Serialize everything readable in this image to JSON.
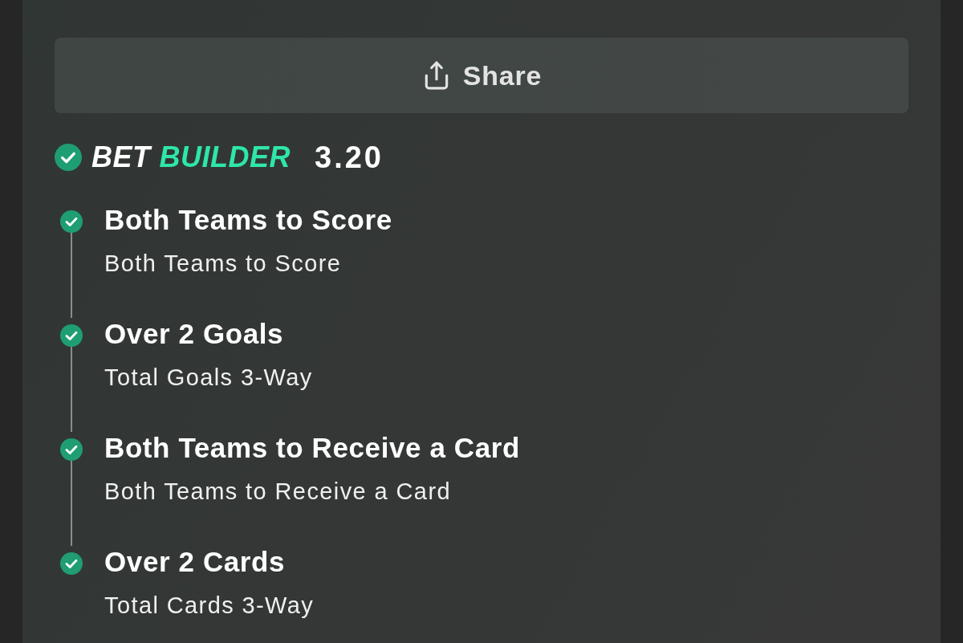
{
  "share_button": {
    "label": "Share"
  },
  "bet_builder": {
    "checked": true,
    "title_first": "BET",
    "title_second": "BUILDER",
    "odds": "3.20"
  },
  "selections": [
    {
      "title": "Both Teams to Score",
      "market": "Both Teams to Score",
      "checked": true
    },
    {
      "title": "Over 2 Goals",
      "market": "Total Goals 3-Way",
      "checked": true
    },
    {
      "title": "Both Teams to Receive a Card",
      "market": "Both Teams to Receive a Card",
      "checked": true
    },
    {
      "title": "Over 2 Cards",
      "market": "Total Cards 3-Way",
      "checked": true
    }
  ]
}
